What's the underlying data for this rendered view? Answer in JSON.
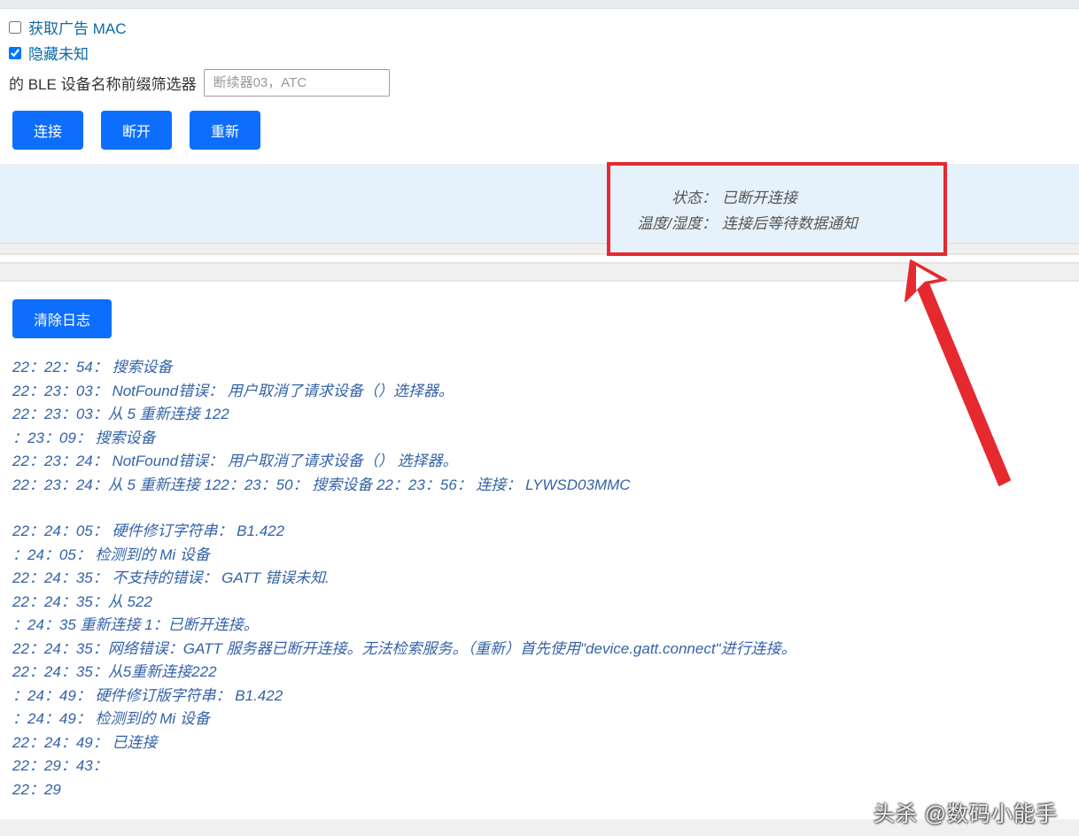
{
  "options": {
    "get_adv_mac": {
      "label": "获取广告 MAC",
      "checked": false
    },
    "hide_unknown": {
      "label": "隐藏未知",
      "checked": true
    }
  },
  "filter": {
    "label": "的 BLE 设备名称前缀筛选器",
    "placeholder": "断续器03，ATC"
  },
  "buttons": {
    "connect": "连接",
    "disconnect": "断开",
    "refresh": "重新",
    "clear_log": "清除日志"
  },
  "status": {
    "label_state": "状态：",
    "value_state": "已断开连接",
    "label_temp": "温度/湿度：",
    "value_temp": "连接后等待数据通知"
  },
  "log_block1": [
    "22：22：54： 搜索设备",
    "22：23：03： NotFound错误： 用户取消了请求设备（）选择器。",
    "22：23：03：从 5 重新连接 122",
    "：23：09： 搜索设备",
    "22：23：24： NotFound错误： 用户取消了请求设备（） 选择器。",
    "22：23：24：从 5 重新连接 122：23：50： 搜索设备 22：23：56： 连接： LYWSD03MMC"
  ],
  "log_block2": [
    "22：24：05： 硬件修订字符串： B1.422",
    "：24：05： 检测到的 Mi 设备",
    "22：24：35： 不支持的错误： GATT 错误未知.",
    "22：24：35：从 522",
    "：24：35 重新连接 1：已断开连接。",
    "22：24：35：网络错误：GATT 服务器已断开连接。无法检索服务。（重新）首先使用\"device.gatt.connect\"进行连接。",
    "22：24：35：从5重新连接222",
    "：24：49： 硬件修订版字符串： B1.422",
    "：24：49： 检测到的 Mi 设备",
    "22：24：49： 已连接",
    "22：29：43：",
    "22：29"
  ],
  "watermark": "头杀 @数码小能手",
  "colors": {
    "primary": "#0d6efd",
    "highlight": "#e6292f",
    "log_text": "#3563a8",
    "status_bg": "#e6f2fb"
  }
}
